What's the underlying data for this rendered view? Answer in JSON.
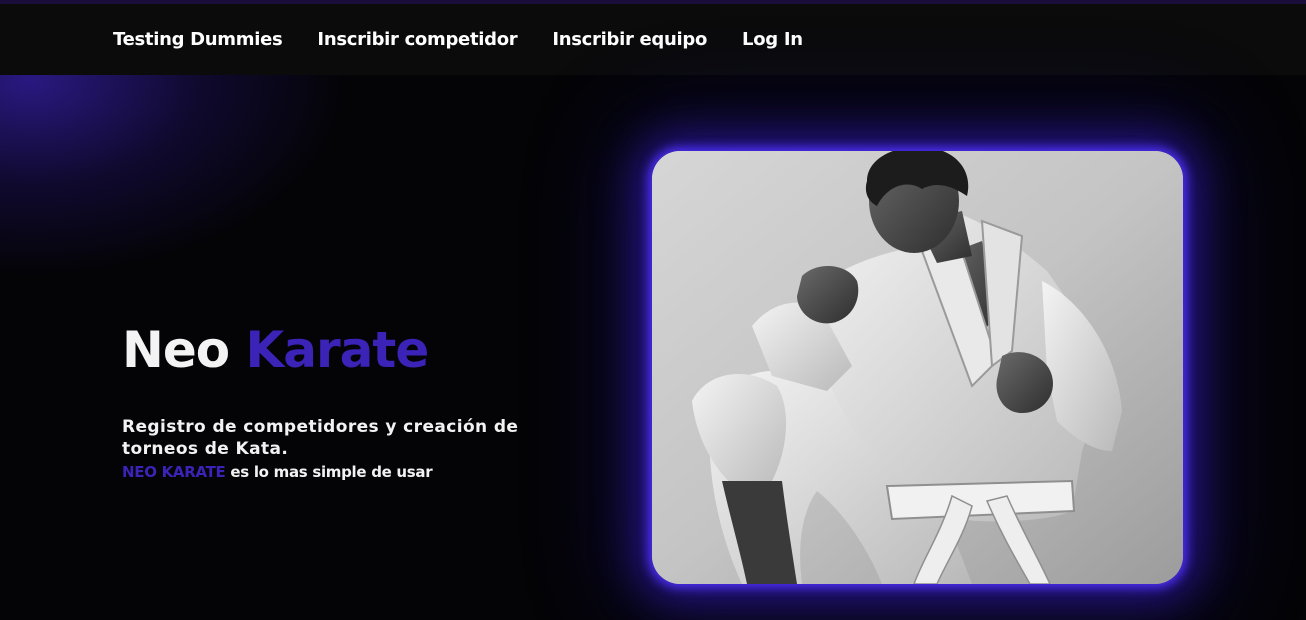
{
  "nav": {
    "items": [
      {
        "label": "Testing Dummies"
      },
      {
        "label": "Inscribir competidor"
      },
      {
        "label": "Inscribir equipo"
      },
      {
        "label": "Log In"
      }
    ]
  },
  "hero": {
    "title_part1": "Neo",
    "title_part2": "Karate",
    "description": "Registro de competidores y creación de torneos de Kata.",
    "tagline_brand": "NEO KARATE",
    "tagline_rest": "es lo mas simple de usar",
    "image_alt": "karate-athlete-photo"
  },
  "colors": {
    "accent": "#3b23b8",
    "background": "#040407",
    "navbar": "#0b0b0c",
    "glow": "#5032ff"
  }
}
